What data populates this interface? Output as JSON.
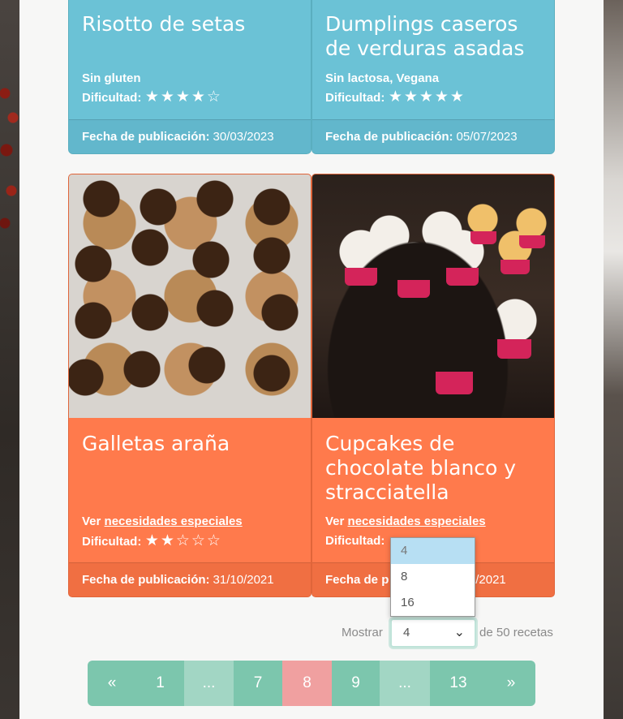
{
  "cards": [
    {
      "title": "Risotto de setas",
      "tags": "Sin gluten",
      "difficulty_label": "Dificultad:",
      "difficulty": 4,
      "date_label": "Fecha de publicación:",
      "date": "30/03/2023"
    },
    {
      "title": "Dumplings caseros de verduras asadas",
      "tags": "Sin lactosa, Vegana",
      "difficulty_label": "Dificultad:",
      "difficulty": 5,
      "date_label": "Fecha de publicación:",
      "date": "05/07/2023"
    },
    {
      "title": "Galletas araña",
      "see_label": "Ver",
      "see_link": "necesidades especiales",
      "difficulty_label": "Dificultad:",
      "difficulty": 2,
      "date_label": "Fecha de publicación:",
      "date": "31/10/2021"
    },
    {
      "title": "Cupcakes de chocolate blanco y stracciatella",
      "see_label": "Ver",
      "see_link": "necesidades especiales",
      "difficulty_label": "Dificultad:",
      "date_label": "Fecha de p",
      "date": "/12/2021"
    }
  ],
  "dropdown": {
    "options": [
      "4",
      "8",
      "16"
    ],
    "selected": "4"
  },
  "show": {
    "label_left": "Mostrar",
    "value": "4",
    "label_right": "de 50 recetas"
  },
  "pagination": [
    "«",
    "1",
    "...",
    "7",
    "8",
    "9",
    "...",
    "13",
    "»"
  ],
  "stars": {
    "filled": "★",
    "empty": "☆"
  },
  "colors": {
    "blue_card": "#6bc2d6",
    "orange_card": "#ff7a4c",
    "pager": "#7cc6ad",
    "pager_active": "#f0a0a0"
  }
}
